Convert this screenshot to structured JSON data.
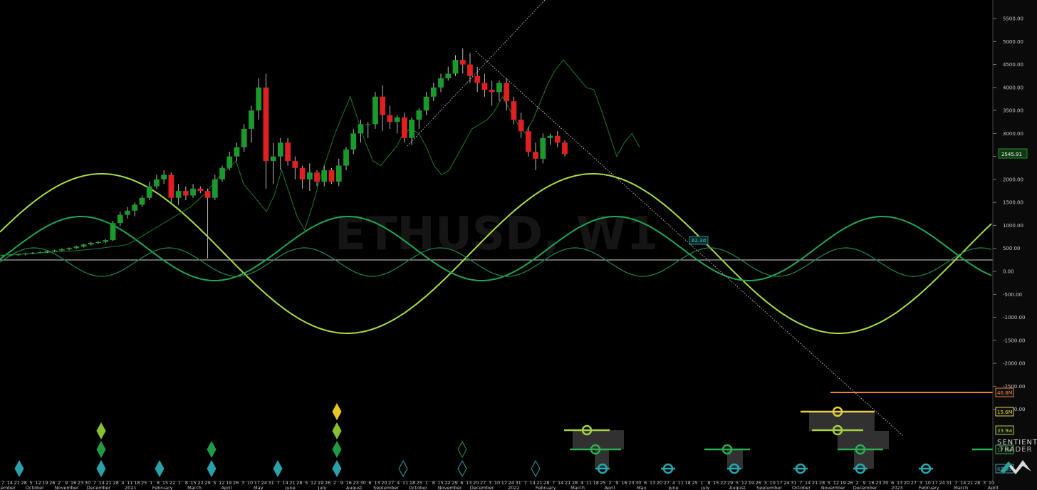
{
  "chart_data": {
    "type": "candlestick",
    "symbol_watermark": "ETHUSD, W1",
    "last_price": "2545.91",
    "ylim": [
      -3300,
      5800
    ],
    "price_ticks": [
      "5500.00",
      "5000.00",
      "4500.00",
      "4000.00",
      "3500.00",
      "3000.00",
      "2500.00",
      "2000.00",
      "1500.00",
      "1000.00",
      "500.00",
      "0.00",
      "-500.00",
      "-1000.00",
      "-1500.00",
      "-2000.00",
      "-2500.00",
      "-3000.00"
    ],
    "price_tick_values": [
      5500,
      5000,
      4500,
      4000,
      3500,
      3000,
      2500,
      2000,
      1500,
      1000,
      500,
      0,
      -500,
      -1000,
      -1500,
      -2000,
      -2500,
      -3000
    ],
    "candles_ohlc": [
      [
        340,
        360,
        320,
        350
      ],
      [
        350,
        370,
        330,
        360
      ],
      [
        360,
        380,
        340,
        370
      ],
      [
        370,
        400,
        350,
        385
      ],
      [
        385,
        420,
        370,
        405
      ],
      [
        405,
        430,
        390,
        415
      ],
      [
        415,
        450,
        400,
        440
      ],
      [
        440,
        470,
        420,
        455
      ],
      [
        455,
        500,
        440,
        480
      ],
      [
        480,
        520,
        460,
        505
      ],
      [
        505,
        560,
        490,
        540
      ],
      [
        540,
        600,
        520,
        585
      ],
      [
        585,
        640,
        560,
        620
      ],
      [
        620,
        660,
        600,
        640
      ],
      [
        640,
        700,
        620,
        680
      ],
      [
        680,
        1100,
        660,
        1050
      ],
      [
        1050,
        1300,
        980,
        1230
      ],
      [
        1230,
        1400,
        1150,
        1320
      ],
      [
        1320,
        1500,
        1200,
        1450
      ],
      [
        1450,
        1650,
        1400,
        1600
      ],
      [
        1600,
        1950,
        1550,
        1850
      ],
      [
        1850,
        2100,
        1800,
        2000
      ],
      [
        2000,
        2200,
        1900,
        2100
      ],
      [
        2100,
        2150,
        1500,
        1600
      ],
      [
        1600,
        1900,
        1450,
        1750
      ],
      [
        1750,
        1850,
        1550,
        1650
      ],
      [
        1650,
        1900,
        1600,
        1800
      ],
      [
        1800,
        1850,
        1700,
        1750
      ],
      [
        1750,
        1800,
        280,
        1600
      ],
      [
        1600,
        2100,
        1550,
        2000
      ],
      [
        2000,
        2300,
        1950,
        2250
      ],
      [
        2250,
        2600,
        2200,
        2500
      ],
      [
        2500,
        2800,
        2400,
        2700
      ],
      [
        2700,
        3200,
        2600,
        3100
      ],
      [
        3100,
        3600,
        2800,
        3500
      ],
      [
        3500,
        4200,
        3300,
        4000
      ],
      [
        4000,
        4300,
        1800,
        2400
      ],
      [
        2400,
        2800,
        1900,
        2500
      ],
      [
        2500,
        2900,
        2200,
        2800
      ],
      [
        2800,
        2900,
        2300,
        2400
      ],
      [
        2400,
        2500,
        2000,
        2250
      ],
      [
        2250,
        2300,
        1800,
        2000
      ],
      [
        2000,
        2350,
        1750,
        2150
      ],
      [
        2150,
        2200,
        1850,
        1950
      ],
      [
        1950,
        2300,
        1850,
        2200
      ],
      [
        2200,
        2250,
        1900,
        1950
      ],
      [
        1950,
        2450,
        1850,
        2300
      ],
      [
        2300,
        2700,
        2200,
        2650
      ],
      [
        2650,
        3100,
        2550,
        3000
      ],
      [
        3000,
        3300,
        2800,
        3200
      ],
      [
        3200,
        3250,
        2900,
        3200
      ],
      [
        3200,
        3900,
        3100,
        3800
      ],
      [
        3800,
        4050,
        3050,
        3400
      ],
      [
        3400,
        3600,
        3100,
        3250
      ],
      [
        3250,
        3400,
        3000,
        3350
      ],
      [
        3350,
        3450,
        2800,
        2900
      ],
      [
        2900,
        3350,
        2750,
        3300
      ],
      [
        3300,
        3550,
        3100,
        3500
      ],
      [
        3500,
        3900,
        3400,
        3800
      ],
      [
        3800,
        4100,
        3700,
        4000
      ],
      [
        4000,
        4300,
        3900,
        4200
      ],
      [
        4200,
        4450,
        4150,
        4300
      ],
      [
        4300,
        4700,
        4250,
        4600
      ],
      [
        4600,
        4850,
        4300,
        4500
      ],
      [
        4500,
        4750,
        4100,
        4250
      ],
      [
        4250,
        4450,
        3900,
        4100
      ],
      [
        4100,
        4300,
        3800,
        3950
      ],
      [
        3950,
        4150,
        3600,
        3900
      ],
      [
        3900,
        4150,
        3700,
        4100
      ],
      [
        4100,
        4200,
        3500,
        3700
      ],
      [
        3700,
        3800,
        3200,
        3300
      ],
      [
        3300,
        3450,
        2900,
        3050
      ],
      [
        3050,
        3150,
        2500,
        2600
      ],
      [
        2600,
        2800,
        2200,
        2450
      ],
      [
        2450,
        3000,
        2350,
        2900
      ],
      [
        2900,
        3000,
        2750,
        2950
      ],
      [
        2950,
        3050,
        2700,
        2800
      ],
      [
        2800,
        2850,
        2500,
        2550
      ]
    ],
    "price_cycle_line": [
      350,
      360,
      370,
      380,
      390,
      400,
      410,
      420,
      430,
      440,
      450,
      470,
      480,
      500,
      520,
      540,
      560,
      600,
      700,
      800,
      900,
      1000,
      1100,
      1200,
      1300,
      1400,
      1550,
      1700,
      1900,
      2100,
      2250,
      2400,
      1900,
      1700,
      1500,
      1300,
      1650,
      2200,
      1700,
      1200,
      900,
      1400,
      2000,
      2500,
      3000,
      3400,
      3800,
      3300,
      2800,
      2400,
      2300,
      2500,
      2700,
      3000,
      3100,
      3000,
      2700,
      2300,
      2100,
      2200,
      2500,
      2800,
      3100,
      3200,
      3300,
      3500,
      3800,
      3500,
      3200,
      3000,
      3300,
      3700,
      4100,
      4400,
      4600,
      4400,
      4200,
      4000,
      3950,
      3500,
      3000,
      2500,
      2800,
      3000,
      2700
    ],
    "date_labels": [
      "7",
      "14",
      "21",
      "28",
      "5",
      "12",
      "19",
      "26",
      "2",
      "9",
      "16",
      "23",
      "30",
      "7",
      "14",
      "21",
      "28",
      "4",
      "11",
      "18",
      "25",
      "1",
      "8",
      "15",
      "22",
      "1",
      "8",
      "15",
      "22",
      "29",
      "5",
      "12",
      "19",
      "26",
      "3",
      "10",
      "17",
      "24",
      "31",
      "7",
      "14",
      "21",
      "28",
      "5",
      "12",
      "19",
      "26",
      "2",
      "9",
      "16",
      "23",
      "30",
      "6",
      "13",
      "20",
      "27",
      "4",
      "11",
      "18",
      "25",
      "1",
      "8",
      "15",
      "22",
      "29",
      "6",
      "13",
      "20",
      "27",
      "3",
      "10",
      "17",
      "24",
      "31",
      "7",
      "14",
      "21",
      "28",
      "7",
      "14",
      "21",
      "28",
      "4",
      "11",
      "18",
      "25",
      "2",
      "9",
      "16",
      "23",
      "30",
      "6",
      "13",
      "20",
      "27",
      "4",
      "11",
      "18",
      "25",
      "1",
      "8",
      "15",
      "22",
      "29",
      "5",
      "12",
      "19",
      "26",
      "3",
      "10",
      "17",
      "24",
      "31",
      "7",
      "14",
      "21",
      "28",
      "5",
      "12",
      "19",
      "26",
      "2",
      "9",
      "16",
      "23",
      "30",
      "6",
      "13",
      "20",
      "27",
      "3",
      "10",
      "17",
      "24",
      "31",
      "7",
      "14",
      "21",
      "28",
      "3",
      "10"
    ],
    "month_labels": [
      "September",
      "October",
      "November",
      "December",
      "2021",
      "February",
      "March",
      "April",
      "May",
      "June",
      "July",
      "August",
      "September",
      "October",
      "November",
      "December",
      "2022",
      "February",
      "March",
      "April",
      "May",
      "June",
      "July",
      "August",
      "September",
      "October",
      "November",
      "December",
      "2023",
      "February",
      "March",
      "April"
    ],
    "cycle_tags": [
      {
        "label": "46.8M",
        "color": "#e8803a"
      },
      {
        "label": "15.6M",
        "color": "#e8d040"
      },
      {
        "label": "33.9w",
        "color": "#a8d040"
      },
      {
        "label": "17.9w",
        "color": "#3aa850"
      },
      {
        "label": "62.3d",
        "color": "#3aa0a8"
      }
    ],
    "cycle_bar_tag": "62.3d",
    "grid": false
  },
  "brand": {
    "name_top": "SENTIENT",
    "name_bottom": "TRADER"
  },
  "colors": {
    "up": "#1a9a2a",
    "down": "#e02020",
    "bg": "#000000",
    "cycle_light": "#a8e040",
    "cycle_dark": "#2ab060"
  }
}
